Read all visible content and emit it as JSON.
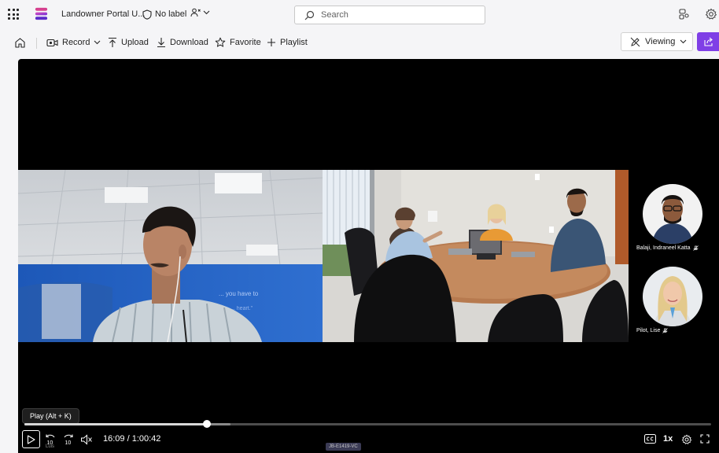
{
  "app": {
    "doc_title": "Landowner Portal U...",
    "sensitivity_label": "No label",
    "search_placeholder": "Search"
  },
  "toolbar": {
    "record": "Record",
    "upload": "Upload",
    "download": "Download",
    "favorite": "Favorite",
    "playlist": "Playlist",
    "viewing": "Viewing"
  },
  "participants": [
    {
      "name": "Balaji, Indraneel Katta"
    },
    {
      "name": "Pilot, Lise"
    }
  ],
  "player": {
    "tooltip": "Play (Alt + K)",
    "time": "16:09 / 1:00:42",
    "progress_fraction": 0.266,
    "buffer_fraction": 0.3,
    "skip_back_seconds": "10",
    "skip_forward_seconds": "10",
    "speed": "1x",
    "room_tag": "JB-E1419-VC",
    "under_text": "Luis"
  },
  "colors": {
    "accent": "#7f3fe6",
    "player_bg": "#000000",
    "chrome_bg": "#f5f5f7"
  },
  "icons": [
    "app-launcher-icon",
    "stream-logo-icon",
    "shield-icon",
    "people-icon",
    "chevron-down-icon",
    "search-icon",
    "share-people-icon",
    "settings-icon",
    "home-icon",
    "record-icon",
    "upload-icon",
    "download-icon",
    "star-icon",
    "plus-icon",
    "pen-off-icon",
    "share-icon",
    "play-icon",
    "rewind-10-icon",
    "forward-10-icon",
    "mute-icon",
    "captions-icon",
    "player-settings-icon",
    "fullscreen-icon"
  ]
}
